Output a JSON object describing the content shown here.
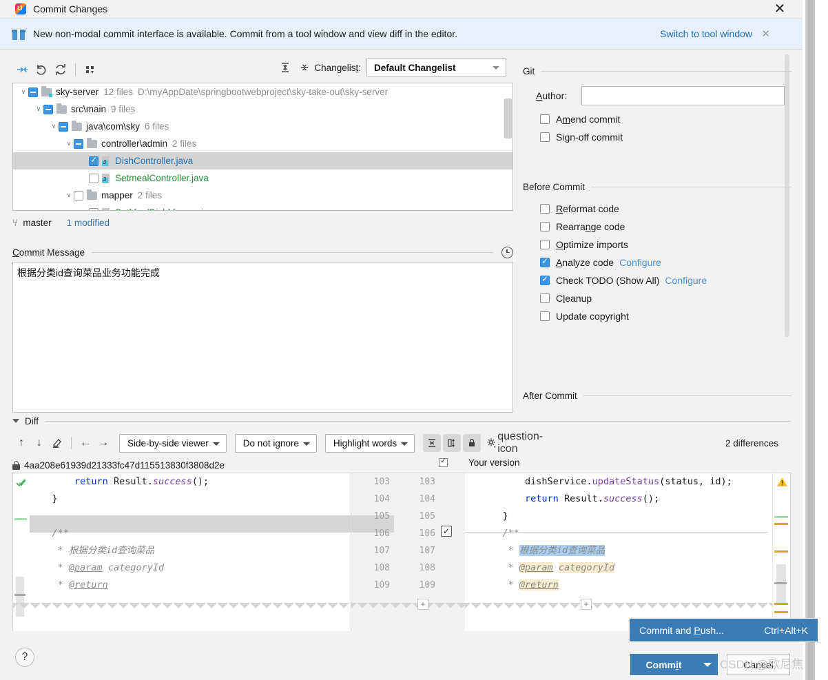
{
  "window": {
    "title": "Commit Changes",
    "close_label": "✕",
    "app_icon": "intellij-idea-icon"
  },
  "banner": {
    "icon": "gift-icon",
    "text": "New non-modal commit interface is available. Commit from a tool window and view diff in the editor.",
    "link": "Switch to tool window",
    "close": "✕"
  },
  "toolbar": {
    "show_diff_icon": "show-diff-icon",
    "rollback_icon": "rollback-icon",
    "refresh_icon": "refresh-icon",
    "group_by_icon": "group-by-icon",
    "expand_all_icon": "expand-all-icon",
    "collapse_all_icon": "collapse-all-icon",
    "changelist_label": "Changelist:",
    "changelist_label_pre": "Changelis",
    "changelist_label_mnemonic": "t",
    "changelist_label_post": ":",
    "changelist_value": "Default Changelist"
  },
  "tree": {
    "rows": [
      {
        "indent": 0,
        "chevron": "∨",
        "check": "partial",
        "icon": "folder-module-icon",
        "name": "sky-server",
        "name_color": "dark",
        "meta": "12 files",
        "path": "D:\\myAppDate\\springbootwebproject\\sky-take-out\\sky-server",
        "selected": false
      },
      {
        "indent": 1,
        "chevron": "∨",
        "check": "partial",
        "icon": "folder-icon",
        "name": "src\\main",
        "name_color": "dark",
        "meta": "9 files",
        "path": "",
        "selected": false
      },
      {
        "indent": 2,
        "chevron": "∨",
        "check": "partial",
        "icon": "folder-icon",
        "name": "java\\com\\sky",
        "name_color": "dark",
        "meta": "6 files",
        "path": "",
        "selected": false
      },
      {
        "indent": 3,
        "chevron": "∨",
        "check": "partial",
        "icon": "folder-icon",
        "name": "controller\\admin",
        "name_color": "dark",
        "meta": "2 files",
        "path": "",
        "selected": false
      },
      {
        "indent": 4,
        "chevron": "",
        "check": "checked",
        "icon": "java-file-icon",
        "name": "DishController.java",
        "name_color": "blue",
        "meta": "",
        "path": "",
        "selected": true
      },
      {
        "indent": 4,
        "chevron": "",
        "check": "unchecked",
        "icon": "java-file-icon",
        "name": "SetmealController.java",
        "name_color": "green",
        "meta": "",
        "path": "",
        "selected": false
      },
      {
        "indent": 3,
        "chevron": "∨",
        "check": "unchecked",
        "icon": "folder-icon",
        "name": "mapper",
        "name_color": "dark",
        "meta": "2 files",
        "path": "",
        "selected": false
      },
      {
        "indent": 4,
        "chevron": "",
        "check": "unchecked",
        "icon": "java-file-icon",
        "name": "SetMealDishMapper.java",
        "name_color": "green",
        "meta": "",
        "path": "",
        "selected": false
      }
    ]
  },
  "branch_bar": {
    "icon": "branch-icon",
    "branch": "master",
    "modified": "1 modified"
  },
  "commit_message": {
    "label_pre": "",
    "label_mnemonic": "C",
    "label_post": "ommit Message",
    "history_icon": "clock-icon",
    "value": "根据分类id查询菜品业务功能完成"
  },
  "options": {
    "git": {
      "group": "Git",
      "author_label_pre": "",
      "author_label_mnemonic": "A",
      "author_label_post": "uthor:",
      "author_value": "",
      "checkboxes": [
        {
          "pre": "A",
          "mnemonic": "m",
          "post": "end commit",
          "checked": false,
          "link": ""
        },
        {
          "pre": "Si",
          "mnemonic": "g",
          "post": "n-off commit",
          "checked": false,
          "link": ""
        }
      ]
    },
    "before_commit": {
      "group": "Before Commit",
      "checkboxes": [
        {
          "pre": "",
          "mnemonic": "R",
          "post": "eformat code",
          "checked": false,
          "link": ""
        },
        {
          "pre": "Rearra",
          "mnemonic": "n",
          "post": "ge code",
          "checked": false,
          "link": ""
        },
        {
          "pre": "",
          "mnemonic": "O",
          "post": "ptimize imports",
          "checked": false,
          "link": ""
        },
        {
          "pre": "",
          "mnemonic": "A",
          "post": "nalyze code",
          "checked": true,
          "link": "Configure"
        },
        {
          "pre": "Check TODO (Show All)",
          "mnemonic": "",
          "post": "",
          "checked": true,
          "link": "Configure"
        },
        {
          "pre": "C",
          "mnemonic": "l",
          "post": "eanup",
          "checked": false,
          "link": ""
        },
        {
          "pre": "Update copyright",
          "mnemonic": "",
          "post": "",
          "checked": false,
          "link": ""
        }
      ]
    },
    "after_commit": {
      "group": "After Commit"
    }
  },
  "diff": {
    "section_label": "Diff",
    "prev_icon": "arrow-up-icon",
    "next_icon": "arrow-down-icon",
    "edit_icon": "edit-source-icon",
    "apply_left_icon": "arrow-left-icon",
    "apply_right_icon": "arrow-right-icon",
    "viewer_mode": "Side-by-side viewer",
    "ignore_mode": "Do not ignore",
    "highlight_mode": "Highlight words",
    "collapse_unchanged_icon": "collapse-unchanged-icon",
    "align_icon": "align-columns-icon",
    "readonly_icon": "lock-icon",
    "settings_icon": "gear-icon",
    "help_icon": "question-icon",
    "differences": "2 differences",
    "revision_lock_icon": "lock-icon",
    "revision_hash": "4aa208e61939d21333fc47d115513830f3808d2e",
    "your_version_label": "Your version",
    "your_version_checked": true,
    "accept_icon": "accept-change-icon",
    "warning_icon": "warning-icon",
    "line_numbers_left": [
      "103",
      "104",
      "105",
      "106",
      "107",
      "108",
      "109"
    ],
    "line_numbers_right": [
      "103",
      "104",
      "105",
      "106",
      "107",
      "108",
      "109"
    ],
    "left_lines": [
      {
        "segments": [
          {
            "t": "        ",
            "c": ""
          },
          {
            "t": "return",
            "c": "kw"
          },
          {
            "t": " Result.",
            "c": ""
          },
          {
            "t": "success",
            "c": "mth ital"
          },
          {
            "t": "();",
            "c": ""
          }
        ]
      },
      {
        "segments": [
          {
            "t": "    }",
            "c": ""
          }
        ]
      },
      {
        "segments": [
          {
            "t": "",
            "c": ""
          }
        ]
      },
      {
        "segments": [
          {
            "t": "    /**",
            "c": "cmt"
          }
        ]
      },
      {
        "segments": [
          {
            "t": "     * 根据分类id查询菜品",
            "c": "cmt"
          }
        ]
      },
      {
        "segments": [
          {
            "t": "     * ",
            "c": "cmt"
          },
          {
            "t": "@param",
            "c": "tag"
          },
          {
            "t": " categoryId",
            "c": "cmt"
          }
        ]
      },
      {
        "segments": [
          {
            "t": "     * ",
            "c": "cmt"
          },
          {
            "t": "@return",
            "c": "tag"
          }
        ]
      }
    ],
    "right_lines": [
      {
        "segments": [
          {
            "t": "        dishService.",
            "c": ""
          },
          {
            "t": "updateStatus",
            "c": "mth"
          },
          {
            "t": "(status, id);",
            "c": ""
          }
        ]
      },
      {
        "segments": [
          {
            "t": "        ",
            "c": ""
          },
          {
            "t": "return",
            "c": "kw"
          },
          {
            "t": " Result.",
            "c": ""
          },
          {
            "t": "success",
            "c": "mth ital"
          },
          {
            "t": "();",
            "c": ""
          }
        ]
      },
      {
        "segments": [
          {
            "t": "    }",
            "c": ""
          }
        ]
      },
      {
        "segments": [
          {
            "t": "    /**",
            "c": "cmt"
          }
        ]
      },
      {
        "segments": [
          {
            "t": "     * ",
            "c": "cmt"
          },
          {
            "t": "根据分类id查询菜品",
            "c": "cmt hl-blue"
          }
        ]
      },
      {
        "segments": [
          {
            "t": "     * ",
            "c": "cmt"
          },
          {
            "t": "@param",
            "c": "tag hl-tan"
          },
          {
            "t": " ",
            "c": "cmt"
          },
          {
            "t": "categoryId",
            "c": "cmt hl-tan"
          }
        ]
      },
      {
        "segments": [
          {
            "t": "     * ",
            "c": "cmt"
          },
          {
            "t": "@return",
            "c": "tag hl-tan"
          }
        ]
      }
    ]
  },
  "footer": {
    "help": "?",
    "popup_label_pre": "Commit and ",
    "popup_label_mnemonic": "P",
    "popup_label_post": "ush...",
    "popup_shortcut": "Ctrl+Alt+K",
    "commit_pre": "Comm",
    "commit_mnemonic": "i",
    "commit_post": "t",
    "commit_dropdown_icon": "chevron-down-icon",
    "cancel": "Cancel"
  },
  "watermark": {
    "text": "CSDN @欧尼焦"
  }
}
